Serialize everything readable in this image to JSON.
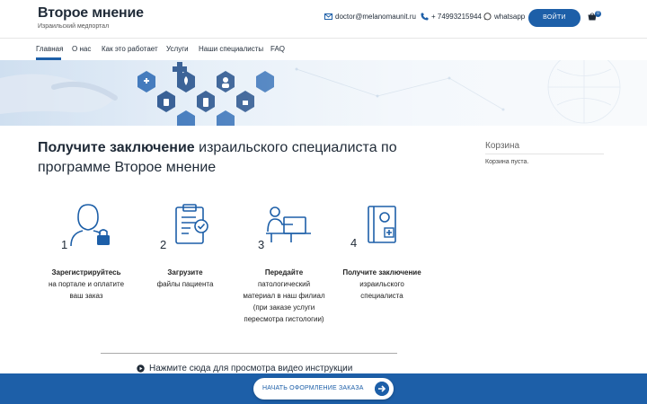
{
  "header": {
    "site_title": "Второе мнение",
    "site_subtitle": "Израильский медпортал",
    "email": "doctor@melanomaunit.ru",
    "phone": "+ 74993215944",
    "whatsapp": "whatsapp",
    "login_label": "ВОЙТИ",
    "cart_count": "0"
  },
  "nav": {
    "items": [
      "Главная",
      "О нас",
      "Как это работает",
      "Услуги",
      "Наши специалисты",
      "FAQ"
    ],
    "active": "Главная"
  },
  "main": {
    "headline_bold": "Получите заключение",
    "headline_rest": " израильского специалиста по программе Второе мнение",
    "steps": [
      {
        "num": "1",
        "title": "Зарегистрируйтесь",
        "lines": [
          "на портале и оплатите",
          "ваш заказ"
        ]
      },
      {
        "num": "2",
        "title": "Загрузите",
        "lines": [
          "файлы пациента"
        ]
      },
      {
        "num": "3",
        "title": "Передайте",
        "lines": [
          "патологический",
          "материал в наш филиал",
          "(при заказе услуги",
          "пересмотра гистологии)"
        ]
      },
      {
        "num": "4",
        "title": "Получите заключение",
        "lines": [
          "израильского",
          "специалиста"
        ]
      }
    ],
    "video_link": "Нажмите сюда для просмотра видео инструкции"
  },
  "sidebar": {
    "cart_title": "Корзина",
    "cart_empty": "Корзина пуста."
  },
  "bottom": {
    "order_button": "НАЧАТЬ ОФОРМЛЕНИЕ ЗАКАЗА"
  },
  "colors": {
    "accent": "#1d5fa8",
    "text": "#1f2a37"
  }
}
